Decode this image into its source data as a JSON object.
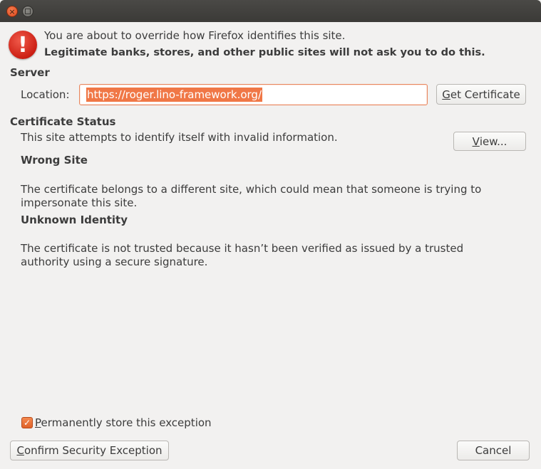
{
  "window": {
    "close_glyph": "×"
  },
  "header": {
    "line1": "You are about to override how Firefox identifies this site.",
    "line2": "Legitimate banks, stores, and other public sites will not ask you to do this."
  },
  "server": {
    "heading": "Server",
    "location_label": "Location:",
    "location_value": "https://roger.lino-framework.org/",
    "get_certificate": {
      "pre": "",
      "accel": "G",
      "post": "et Certificate"
    }
  },
  "status": {
    "heading": "Certificate Status",
    "summary": "This site attempts to identify itself with invalid information.",
    "view_button": {
      "pre": "",
      "accel": "V",
      "post": "iew..."
    },
    "issues": [
      {
        "title": "Wrong Site",
        "line1": "The certificate belongs to a different site, which could mean that someone is trying to",
        "line2": "impersonate this site."
      },
      {
        "title": "Unknown Identity",
        "line1": "The certificate is not trusted because it hasn’t been verified as issued by a trusted",
        "line2": "authority using a secure signature."
      }
    ]
  },
  "footer": {
    "permanent": {
      "pre": "",
      "accel": "P",
      "post": "ermanently store this exception",
      "checked": true
    },
    "confirm": {
      "pre": "",
      "accel": "C",
      "post": "onfirm Security Exception"
    },
    "cancel": "Cancel"
  },
  "colors": {
    "accent": "#e95420",
    "alert": "#cc1f14",
    "background": "#f2f1f0"
  }
}
